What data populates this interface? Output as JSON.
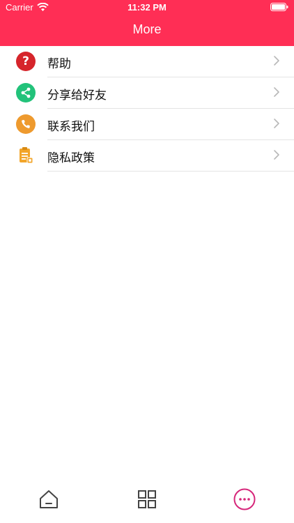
{
  "status_bar": {
    "carrier": "Carrier",
    "time": "11:32 PM"
  },
  "header": {
    "title": "More",
    "color": "#ff2e55"
  },
  "menu": [
    {
      "label": "帮助",
      "icon": "help-icon"
    },
    {
      "label": "分享给好友",
      "icon": "share-icon"
    },
    {
      "label": "联系我们",
      "icon": "phone-icon"
    },
    {
      "label": "隐私政策",
      "icon": "clipboard-icon"
    }
  ],
  "tabbar": [
    {
      "icon": "home-icon",
      "active": false
    },
    {
      "icon": "grid-icon",
      "active": false
    },
    {
      "icon": "more-icon",
      "active": true
    }
  ],
  "colors": {
    "accent": "#ff2e55",
    "active_tab": "#d6267a",
    "inactive_tab": "#444444"
  }
}
